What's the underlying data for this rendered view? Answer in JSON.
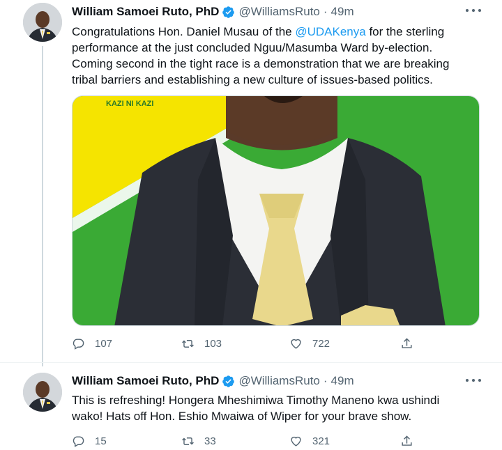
{
  "tweets": [
    {
      "author_name": "William Samoei Ruto, PhD",
      "handle": "@WilliamsRuto",
      "separator": "·",
      "time": "49m",
      "text_lines": [
        [
          "Congratulations Hon. Daniel Musau of the ",
          "@UDAKenya",
          " for the sterling"
        ],
        [
          "performance at the just concluded Nguu/Masumba Ward by-election."
        ],
        [
          "Coming second in the tight race is a demonstration that we are breaking"
        ],
        [
          "tribal barriers and establishing a new culture of issues-based politics."
        ]
      ],
      "media_banner_text": "KAZI NI KAZI",
      "actions": {
        "replies": "107",
        "retweets": "103",
        "likes": "722"
      }
    },
    {
      "author_name": "William Samoei Ruto, PhD",
      "handle": "@WilliamsRuto",
      "separator": "·",
      "time": "49m",
      "text_lines": [
        [
          "This is refreshing! Hongera Mheshimiwa Timothy Maneno kwa ushindi"
        ],
        [
          "wako! Hats off Hon. Eshio Mwaiwa of Wiper for your brave show."
        ]
      ],
      "actions": {
        "replies": "15",
        "retweets": "33",
        "likes": "321"
      }
    }
  ],
  "colors": {
    "link": "#1d9bf0",
    "secondary_text": "#536471",
    "verified_badge": "#1d9bf0",
    "banner_green": "#3aaa35",
    "banner_yellow": "#f5e400"
  },
  "icons": {
    "reply": "reply-icon",
    "retweet": "retweet-icon",
    "like": "heart-icon",
    "share": "share-icon",
    "verified": "verified-badge-icon",
    "more": "more-icon"
  }
}
